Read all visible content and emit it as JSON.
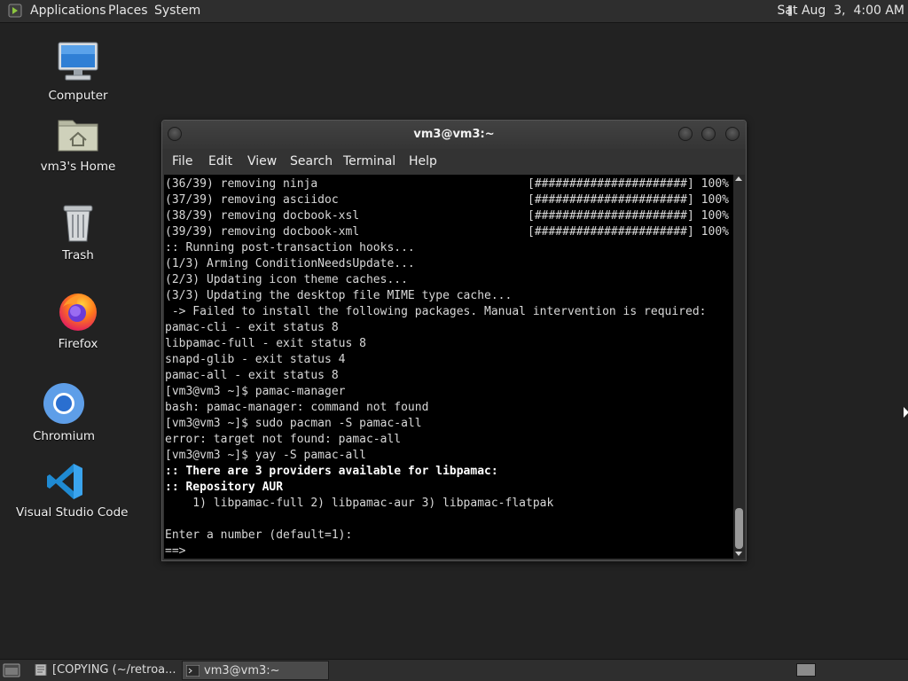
{
  "top_panel": {
    "menus": [
      "Applications",
      "Places",
      "System"
    ],
    "clock": "Sat Aug  3,  4:00 AM"
  },
  "desktop": {
    "icons": [
      {
        "label": "Computer",
        "icon": "computer-icon"
      },
      {
        "label": "vm3's Home",
        "icon": "home-folder-icon"
      },
      {
        "label": "Trash",
        "icon": "trash-icon"
      },
      {
        "label": "Firefox",
        "icon": "firefox-icon"
      },
      {
        "label": "Chromium",
        "icon": "chromium-icon"
      },
      {
        "label": "Visual Studio Code",
        "icon": "vscode-icon"
      }
    ]
  },
  "terminal": {
    "title": "vm3@vm3:~",
    "menu": [
      "File",
      "Edit",
      "View",
      "Search",
      "Terminal",
      "Help"
    ],
    "lines": [
      {
        "text": "(36/39) removing ninja",
        "right": "[######################] 100%",
        "bold": false
      },
      {
        "text": "(37/39) removing asciidoc",
        "right": "[######################] 100%",
        "bold": false
      },
      {
        "text": "(38/39) removing docbook-xsl",
        "right": "[######################] 100%",
        "bold": false
      },
      {
        "text": "(39/39) removing docbook-xml",
        "right": "[######################] 100%",
        "bold": false
      },
      {
        "text": ":: Running post-transaction hooks...",
        "right": "",
        "bold": false
      },
      {
        "text": "(1/3) Arming ConditionNeedsUpdate...",
        "right": "",
        "bold": false
      },
      {
        "text": "(2/3) Updating icon theme caches...",
        "right": "",
        "bold": false
      },
      {
        "text": "(3/3) Updating the desktop file MIME type cache...",
        "right": "",
        "bold": false
      },
      {
        "text": " -> Failed to install the following packages. Manual intervention is required:",
        "right": "",
        "bold": false
      },
      {
        "text": "pamac-cli - exit status 8",
        "right": "",
        "bold": false
      },
      {
        "text": "libpamac-full - exit status 8",
        "right": "",
        "bold": false
      },
      {
        "text": "snapd-glib - exit status 4",
        "right": "",
        "bold": false
      },
      {
        "text": "pamac-all - exit status 8",
        "right": "",
        "bold": false
      },
      {
        "text": "[vm3@vm3 ~]$ pamac-manager",
        "right": "",
        "bold": false
      },
      {
        "text": "bash: pamac-manager: command not found",
        "right": "",
        "bold": false
      },
      {
        "text": "[vm3@vm3 ~]$ sudo pacman -S pamac-all",
        "right": "",
        "bold": false
      },
      {
        "text": "error: target not found: pamac-all",
        "right": "",
        "bold": false
      },
      {
        "text": "[vm3@vm3 ~]$ yay -S pamac-all",
        "right": "",
        "bold": false
      },
      {
        "text": ":: There are 3 providers available for libpamac:",
        "right": "",
        "bold": true
      },
      {
        "text": ":: Repository AUR",
        "right": "",
        "bold": true
      },
      {
        "text": "    1) libpamac-full 2) libpamac-aur 3) libpamac-flatpak",
        "right": "",
        "bold": false
      },
      {
        "text": "",
        "right": "",
        "bold": false
      },
      {
        "text": "Enter a number (default=1):",
        "right": "",
        "bold": false
      },
      {
        "text": "==>",
        "right": "",
        "bold": false
      }
    ]
  },
  "taskbar": {
    "items": [
      {
        "label": "[COPYING (~/retroa...",
        "icon": "text-editor-icon",
        "active": false
      },
      {
        "label": "vm3@vm3:~",
        "icon": "terminal-icon",
        "active": true
      }
    ]
  },
  "colors": {
    "desktop_bg": "#222222",
    "panel_bg": "#2e2e2e",
    "terminal_bg": "#000000",
    "terminal_fg": "#d8d8d8"
  }
}
